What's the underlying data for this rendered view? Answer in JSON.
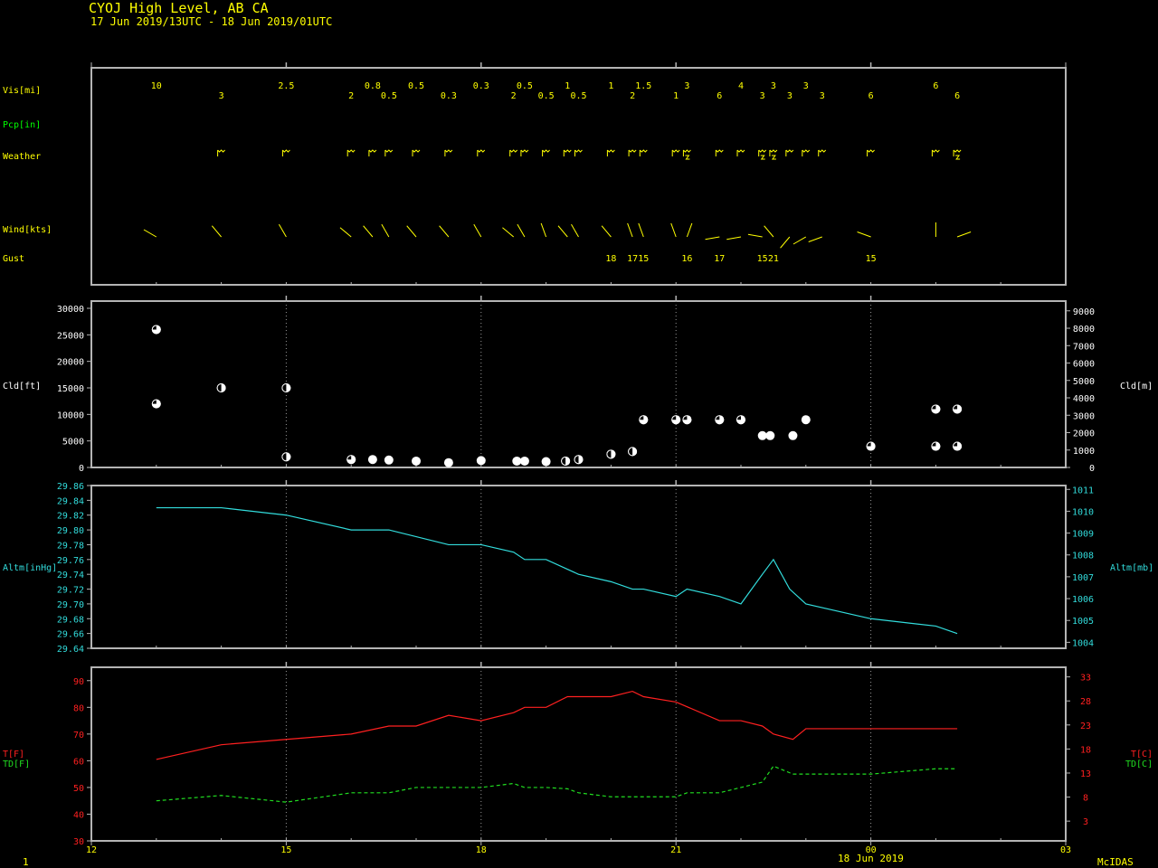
{
  "header": {
    "station_line": "CYOJ  High Level, AB CA",
    "period_line": "17 Jun 2019/13UTC - 18 Jun 2019/01UTC"
  },
  "footer": {
    "page_number": "1",
    "brand": "McIDAS"
  },
  "colors": {
    "frame": "#b4b4b4",
    "grid": "#969696",
    "label_yellow": "#ffff00",
    "label_green": "#00ff00",
    "cyan": "#32dcdc",
    "red": "#ff2020",
    "green": "#20dd20",
    "white": "#ffffff"
  },
  "chart_data": [
    {
      "type": "table",
      "panel": "surface observations",
      "row_labels": {
        "vis": "Vis[mi]",
        "pcp": "Pcp[in]",
        "weather": "Weather",
        "wind": "Wind[kts]",
        "gust": "Gust"
      },
      "x_hours": [
        13,
        14,
        15,
        16,
        16.33,
        16.58,
        17,
        17.5,
        18,
        18.5,
        18.67,
        19,
        19.33,
        19.5,
        20,
        20.33,
        20.5,
        21,
        21.17,
        21.67,
        22,
        22.33,
        22.5,
        22.75,
        23,
        23.25,
        24,
        25,
        25.33
      ],
      "vis": [
        "10",
        "3",
        "2.5",
        "2",
        "0.8",
        "0.5",
        "0.5",
        "0.3",
        "0.3",
        "2",
        "0.5",
        "0.5",
        "1",
        "0.5",
        "1",
        "2",
        "1.5",
        "1",
        "3",
        "6",
        "4",
        "3",
        "3",
        "3",
        "3",
        "3",
        "6",
        "6",
        "6"
      ],
      "vis_row": [
        0,
        1,
        0,
        1,
        0,
        1,
        0,
        1,
        0,
        1,
        0,
        1,
        0,
        1,
        0,
        1,
        0,
        1,
        0,
        1,
        0,
        1,
        0,
        1,
        0,
        1,
        1,
        0,
        1
      ],
      "weather_icons": [
        "",
        "shower-icon",
        "shower-icon",
        "shower-icon",
        "shower-icon",
        "shower-icon",
        "shower-icon",
        "shower-icon",
        "shower-icon",
        "shower-icon",
        "shower-icon",
        "shower-icon",
        "shower-icon",
        "shower-icon",
        "shower-icon",
        "shower-icon",
        "shower-icon",
        "shower-icon",
        "thunder-icon",
        "shower-icon",
        "shower-icon",
        "thunder-icon",
        "thunder-icon",
        "shower-icon",
        "shower-icon",
        "shower-icon",
        "shower-icon",
        "shower-icon",
        "thunder-icon"
      ],
      "wind_dir_deg": [
        300,
        320,
        330,
        310,
        320,
        330,
        320,
        320,
        330,
        310,
        330,
        340,
        320,
        330,
        320,
        340,
        340,
        340,
        20,
        260,
        260,
        280,
        320,
        220,
        240,
        250,
        290,
        0,
        70
      ],
      "gust": [
        null,
        null,
        null,
        null,
        null,
        null,
        null,
        null,
        null,
        null,
        null,
        null,
        null,
        null,
        "18",
        "17",
        "15",
        null,
        "16",
        "17",
        null,
        "15",
        "21",
        null,
        null,
        null,
        "15",
        null,
        null
      ]
    },
    {
      "type": "scatter",
      "panel": "cloud",
      "ylabel_left": "Cld[ft]",
      "ylabel_right": "Cld[m]",
      "ylim": [
        0,
        30000
      ],
      "yticks_left": [
        0,
        5000,
        10000,
        15000,
        20000,
        25000,
        30000
      ],
      "yticks_right": [
        0,
        1000,
        2000,
        3000,
        4000,
        5000,
        6000,
        7000,
        8000,
        9000
      ],
      "points": [
        {
          "x": 13,
          "y": 26000,
          "cover": 0.75
        },
        {
          "x": 13,
          "y": 12000,
          "cover": 0.75
        },
        {
          "x": 14,
          "y": 15000,
          "cover": 0.5
        },
        {
          "x": 15,
          "y": 15000,
          "cover": 0.5
        },
        {
          "x": 15,
          "y": 2000,
          "cover": 0.5
        },
        {
          "x": 16,
          "y": 1500,
          "cover": 0.75
        },
        {
          "x": 16.33,
          "y": 1500,
          "cover": 1
        },
        {
          "x": 16.58,
          "y": 1400,
          "cover": 1
        },
        {
          "x": 17,
          "y": 1200,
          "cover": 1
        },
        {
          "x": 17.5,
          "y": 900,
          "cover": 1
        },
        {
          "x": 18,
          "y": 1300,
          "cover": 1
        },
        {
          "x": 18.55,
          "y": 1200,
          "cover": 1
        },
        {
          "x": 18.67,
          "y": 1200,
          "cover": 1
        },
        {
          "x": 19,
          "y": 1100,
          "cover": 1
        },
        {
          "x": 19.3,
          "y": 1200,
          "cover": 0.5
        },
        {
          "x": 19.5,
          "y": 1500,
          "cover": 0.5
        },
        {
          "x": 20,
          "y": 2500,
          "cover": 0.5
        },
        {
          "x": 20.33,
          "y": 3000,
          "cover": 0.5
        },
        {
          "x": 20.5,
          "y": 9000,
          "cover": 0.75
        },
        {
          "x": 21,
          "y": 9000,
          "cover": 0.75
        },
        {
          "x": 21.17,
          "y": 9000,
          "cover": 0.75
        },
        {
          "x": 21.67,
          "y": 9000,
          "cover": 0.75
        },
        {
          "x": 22,
          "y": 9000,
          "cover": 0.75
        },
        {
          "x": 22.33,
          "y": 6000,
          "cover": 1
        },
        {
          "x": 22.45,
          "y": 6000,
          "cover": 1
        },
        {
          "x": 22.8,
          "y": 6000,
          "cover": 1
        },
        {
          "x": 23,
          "y": 9000,
          "cover": 1
        },
        {
          "x": 24,
          "y": 4000,
          "cover": 0.75
        },
        {
          "x": 25,
          "y": 11000,
          "cover": 0.75
        },
        {
          "x": 25,
          "y": 4000,
          "cover": 0.75
        },
        {
          "x": 25.33,
          "y": 11000,
          "cover": 0.75
        },
        {
          "x": 25.33,
          "y": 4000,
          "cover": 0.75
        }
      ]
    },
    {
      "type": "line",
      "panel": "altimeter",
      "ylabel_left": "Altm[inHg]",
      "ylabel_right": "Altm[mb]",
      "ylim": [
        29.64,
        29.86
      ],
      "yticks_left": [
        "29.64",
        "29.66",
        "29.68",
        "29.70",
        "29.72",
        "29.74",
        "29.76",
        "29.78",
        "29.80",
        "29.82",
        "29.84",
        "29.86"
      ],
      "yticks_right": [
        "1004",
        "1005",
        "1006",
        "1007",
        "1008",
        "1009",
        "1010",
        "1011"
      ],
      "series": [
        {
          "x": [
            13,
            14,
            15,
            16,
            16.58,
            17.5,
            18,
            18.5,
            18.67,
            19,
            19.5,
            20,
            20.33,
            20.5,
            21,
            21.17,
            21.67,
            22,
            22.33,
            22.5,
            22.75,
            23,
            24,
            25,
            25.33
          ],
          "values": [
            29.83,
            29.83,
            29.82,
            29.8,
            29.8,
            29.78,
            29.78,
            29.77,
            29.76,
            29.76,
            29.74,
            29.73,
            29.72,
            29.72,
            29.71,
            29.72,
            29.71,
            29.7,
            29.74,
            29.76,
            29.72,
            29.7,
            29.68,
            29.67,
            29.66
          ]
        }
      ]
    },
    {
      "type": "line",
      "panel": "temperature",
      "ylabel_left": [
        "T[F]",
        "TD[F]"
      ],
      "ylabel_right": [
        "T[C]",
        "TD[C]"
      ],
      "ylim": [
        30,
        95
      ],
      "yticks_left": [
        30,
        40,
        50,
        60,
        70,
        80,
        90
      ],
      "yticks_right": [
        "3",
        "8",
        "13",
        "18",
        "23",
        "28",
        "33"
      ],
      "x_ticks": [
        "12",
        "15",
        "18",
        "21",
        "00",
        "03"
      ],
      "x_date": "18 Jun 2019",
      "series": [
        {
          "x": [
            13,
            14,
            15,
            16,
            16.58,
            17,
            17.5,
            18,
            18.5,
            18.67,
            19,
            19.33,
            19.5,
            20,
            20.33,
            20.5,
            21,
            21.67,
            22,
            22.33,
            22.5,
            22.8,
            23,
            24,
            25,
            25.33
          ],
          "values": [
            60.5,
            66,
            68,
            70,
            73,
            73,
            77,
            75,
            78,
            80,
            80,
            84,
            84,
            84,
            86,
            84,
            82,
            75,
            75,
            73,
            70,
            68,
            72,
            72,
            72,
            72
          ]
        },
        {
          "x": [
            13,
            14,
            15,
            16,
            16.58,
            17,
            17.5,
            18,
            18.5,
            18.67,
            19,
            19.33,
            19.5,
            20,
            20.5,
            21,
            21.17,
            21.67,
            22,
            22.33,
            22.5,
            22.8,
            23,
            24,
            25,
            25.33
          ],
          "values": [
            45,
            47,
            44.5,
            48,
            48,
            50,
            50,
            50,
            51.5,
            50,
            50,
            49.5,
            48,
            46.5,
            46.5,
            46.5,
            48,
            48,
            50,
            52,
            58,
            55,
            55,
            55,
            57,
            57
          ]
        }
      ]
    }
  ]
}
